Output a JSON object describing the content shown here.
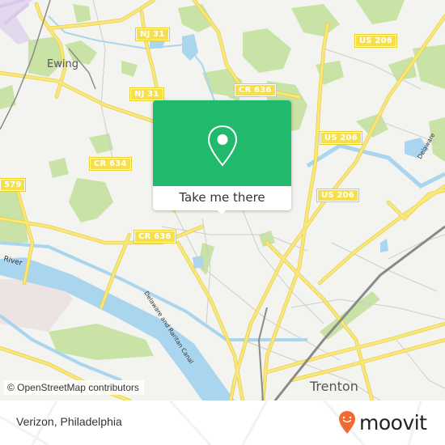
{
  "map": {
    "place_labels": [
      {
        "id": "ewing",
        "text": "Ewing"
      },
      {
        "id": "trenton",
        "text": "Trenton"
      }
    ],
    "road_shields": [
      {
        "id": "nj31-top",
        "text": "NJ 31"
      },
      {
        "id": "nj31-mid",
        "text": "NJ 31"
      },
      {
        "id": "cr636-top",
        "text": "CR 636"
      },
      {
        "id": "us206-top",
        "text": "US 206"
      },
      {
        "id": "us206-mid",
        "text": "US 206"
      },
      {
        "id": "us206-low",
        "text": "US 206"
      },
      {
        "id": "cr634",
        "text": "CR 634"
      },
      {
        "id": "r579",
        "text": "579"
      },
      {
        "id": "cr636-low",
        "text": "CR 636"
      }
    ],
    "water_labels": [
      {
        "id": "river",
        "text": "River"
      },
      {
        "id": "canal",
        "text": "Delaware and Raritan Canal"
      },
      {
        "id": "delaware",
        "text": "Delaware"
      }
    ],
    "colors": {
      "background": "#f3f3ef",
      "park": "#c8e3a5",
      "water": "#a9d6ee",
      "road": "#f6e26a",
      "road_casing": "#e8cf45",
      "rail": "#8a8a8a",
      "minor_road": "#c8c8c8",
      "airport": "#e3d9ef",
      "industrial": "#ece4e2"
    }
  },
  "popup": {
    "icon": "map-pin-icon",
    "button_label": "Take me there",
    "accent_color": "#21ba6d"
  },
  "attribution": "© OpenStreetMap contributors",
  "footer": {
    "title": "Verizon, Philadelphia",
    "brand": "moovit",
    "brand_color": "#f26a32"
  }
}
